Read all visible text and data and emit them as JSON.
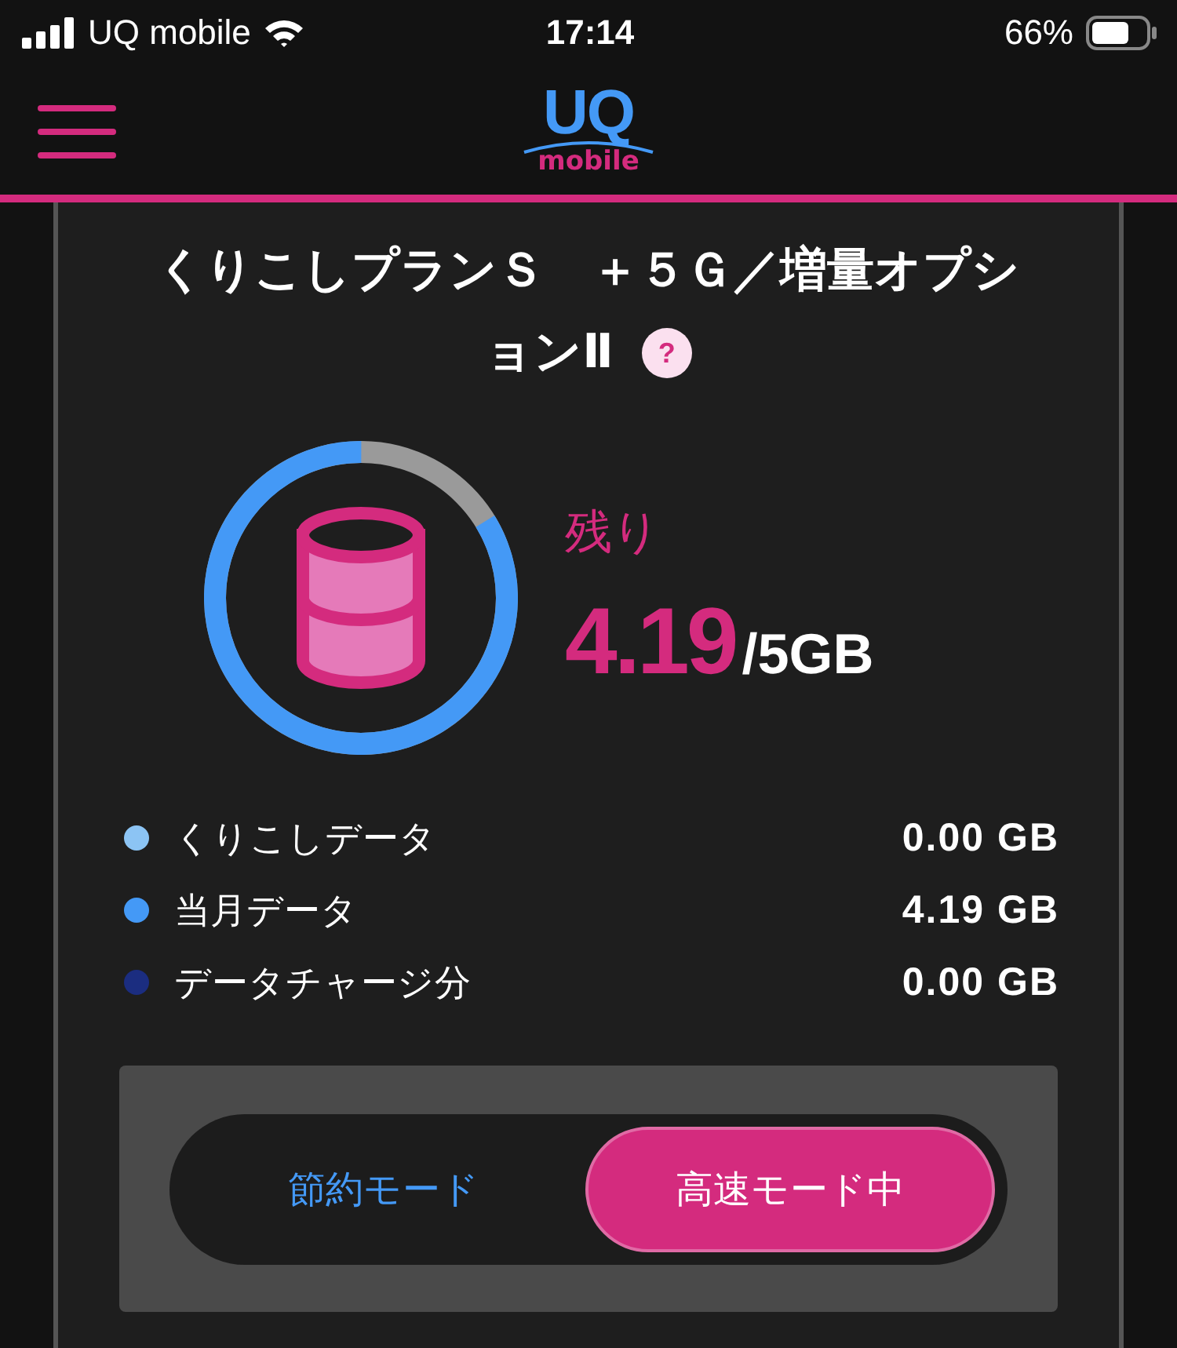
{
  "status_bar": {
    "carrier": "UQ mobile",
    "time": "17:14",
    "battery": "66%"
  },
  "header": {
    "logo_top": "UQ",
    "logo_bottom": "mobile"
  },
  "plan": {
    "title_lines": [
      "くりこしプランＳ　＋５Ｇ／増量オプシ",
      "ョンⅡ"
    ],
    "help": "?"
  },
  "usage": {
    "level": 0.838,
    "remaining_label": "残り",
    "remaining": "4.19",
    "total": "/5GB"
  },
  "breakdown": [
    {
      "label": "くりこしデータ",
      "value": "0.00 GB",
      "color": "#8cc4f4"
    },
    {
      "label": "当月データ",
      "value": "4.19 GB",
      "color": "#4499f6"
    },
    {
      "label": "データチャージ分",
      "value": "0.00 GB",
      "color": "#1b2d80"
    }
  ],
  "modes": [
    {
      "label": "節約モード",
      "selected": false
    },
    {
      "label": "高速モード中",
      "selected": true
    }
  ]
}
